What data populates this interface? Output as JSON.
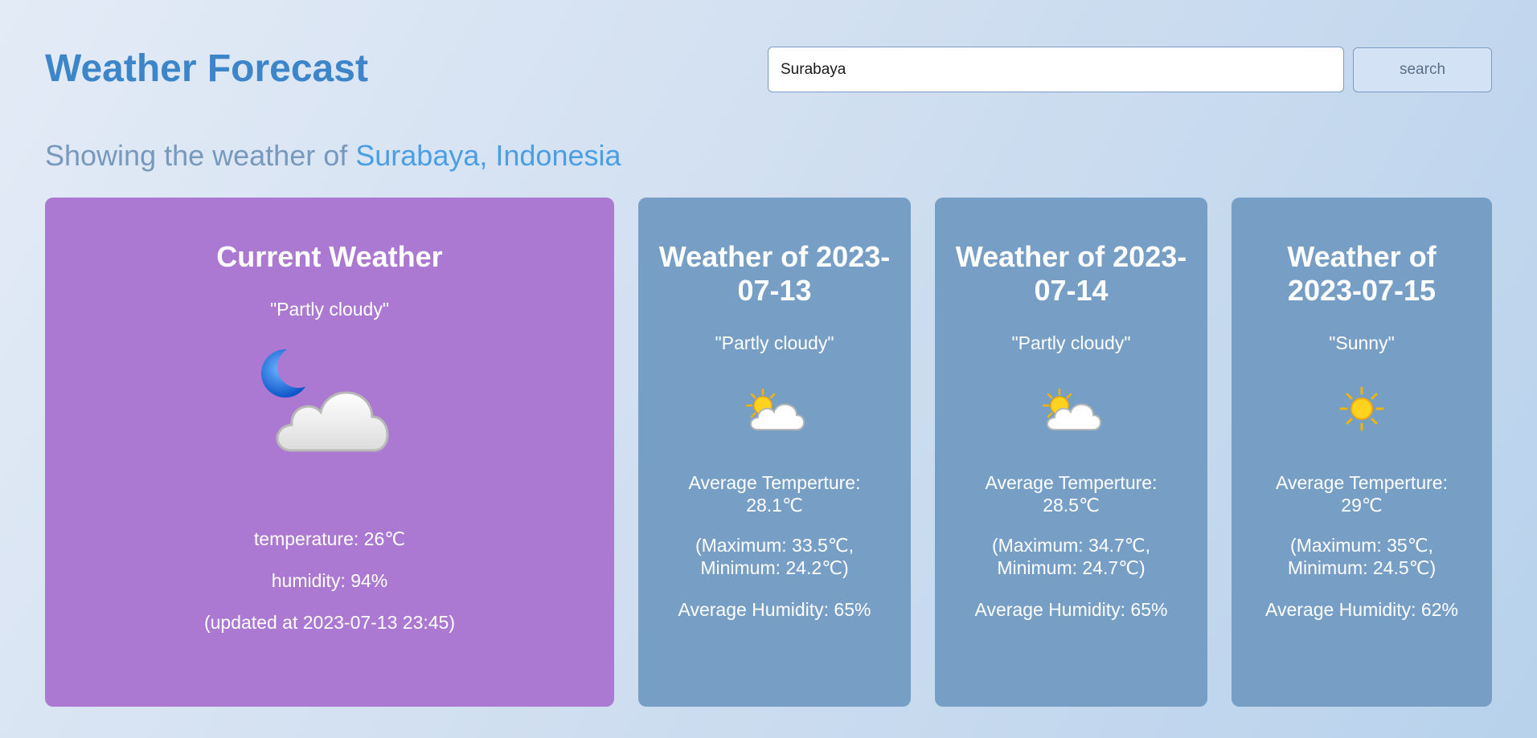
{
  "header": {
    "title": "Weather Forecast",
    "search_value": "Surabaya",
    "search_button": "search"
  },
  "location": {
    "prefix": "Showing the weather of",
    "name": "Surabaya, Indonesia"
  },
  "current": {
    "title": "Current Weather",
    "condition": "\"Partly cloudy\"",
    "icon": "moon-cloud-icon",
    "temperature": "temperature: 26℃",
    "humidity": "humidity: 94%",
    "updated": "(updated at 2023-07-13 23:45)"
  },
  "forecast": [
    {
      "title": "Weather of 2023-07-13",
      "condition": "\"Partly cloudy\"",
      "icon": "partly-cloudy-icon",
      "avg_label": "Average Temperture:",
      "avg_temp": "28.1℃",
      "max": "(Maximum: 33.5℃,",
      "min": "Minimum: 24.2℃)",
      "humidity": "Average Humidity: 65%"
    },
    {
      "title": "Weather of 2023-07-14",
      "condition": "\"Partly cloudy\"",
      "icon": "partly-cloudy-icon",
      "avg_label": "Average Temperture:",
      "avg_temp": "28.5℃",
      "max": "(Maximum: 34.7℃,",
      "min": "Minimum: 24.7℃)",
      "humidity": "Average Humidity: 65%"
    },
    {
      "title": "Weather of 2023-07-15",
      "condition": "\"Sunny\"",
      "icon": "sun-icon",
      "avg_label": "Average Temperture:",
      "avg_temp": "29℃",
      "max": "(Maximum: 35℃,",
      "min": "Minimum: 24.5℃)",
      "humidity": "Average Humidity: 62%"
    }
  ],
  "colors": {
    "title": "#3d85c9",
    "location_name": "#4a9ee3",
    "current_card": "#ab79d1",
    "forecast_card": "#779fc5"
  }
}
